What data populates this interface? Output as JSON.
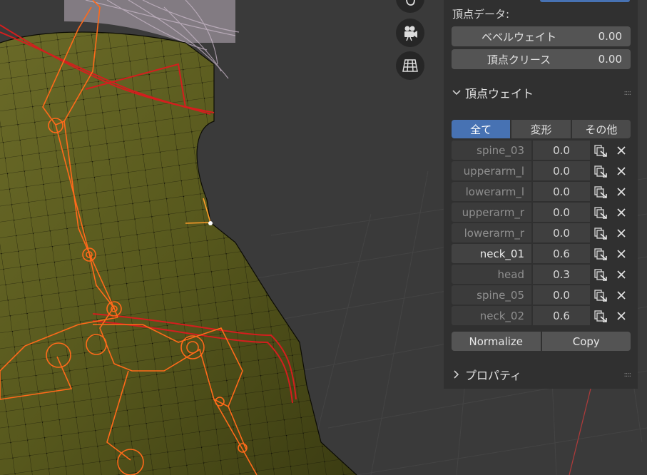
{
  "vertex_data": {
    "label": "頂点データ:",
    "fields": [
      {
        "label": "ベベルウェイト",
        "value": "0.00"
      },
      {
        "label": "頂点クリース",
        "value": "0.00"
      }
    ]
  },
  "vertex_weights": {
    "title": "頂点ウェイト",
    "tabs": [
      "全て",
      "変形",
      "その他"
    ],
    "active_tab": 0,
    "rows": [
      {
        "name": "spine_03",
        "value": "0.0"
      },
      {
        "name": "upperarm_l",
        "value": "0.0"
      },
      {
        "name": "lowerarm_l",
        "value": "0.0"
      },
      {
        "name": "upperarm_r",
        "value": "0.0"
      },
      {
        "name": "lowerarm_r",
        "value": "0.0"
      },
      {
        "name": "neck_01",
        "value": "0.6"
      },
      {
        "name": "head",
        "value": "0.3"
      },
      {
        "name": "spine_05",
        "value": "0.0"
      },
      {
        "name": "neck_02",
        "value": "0.6"
      }
    ],
    "normalize_label": "Normalize",
    "copy_label": "Copy"
  },
  "properties": {
    "title": "プロパティ"
  },
  "colors": {
    "accent": "#4772b3",
    "mesh": "#5a5a1e",
    "bone": "#ff6a1a"
  },
  "icons": [
    "hand-icon",
    "camera-icon",
    "grid-icon",
    "chevron-down-icon",
    "chevron-right-icon",
    "grip-icon",
    "copy-icon",
    "close-icon"
  ]
}
